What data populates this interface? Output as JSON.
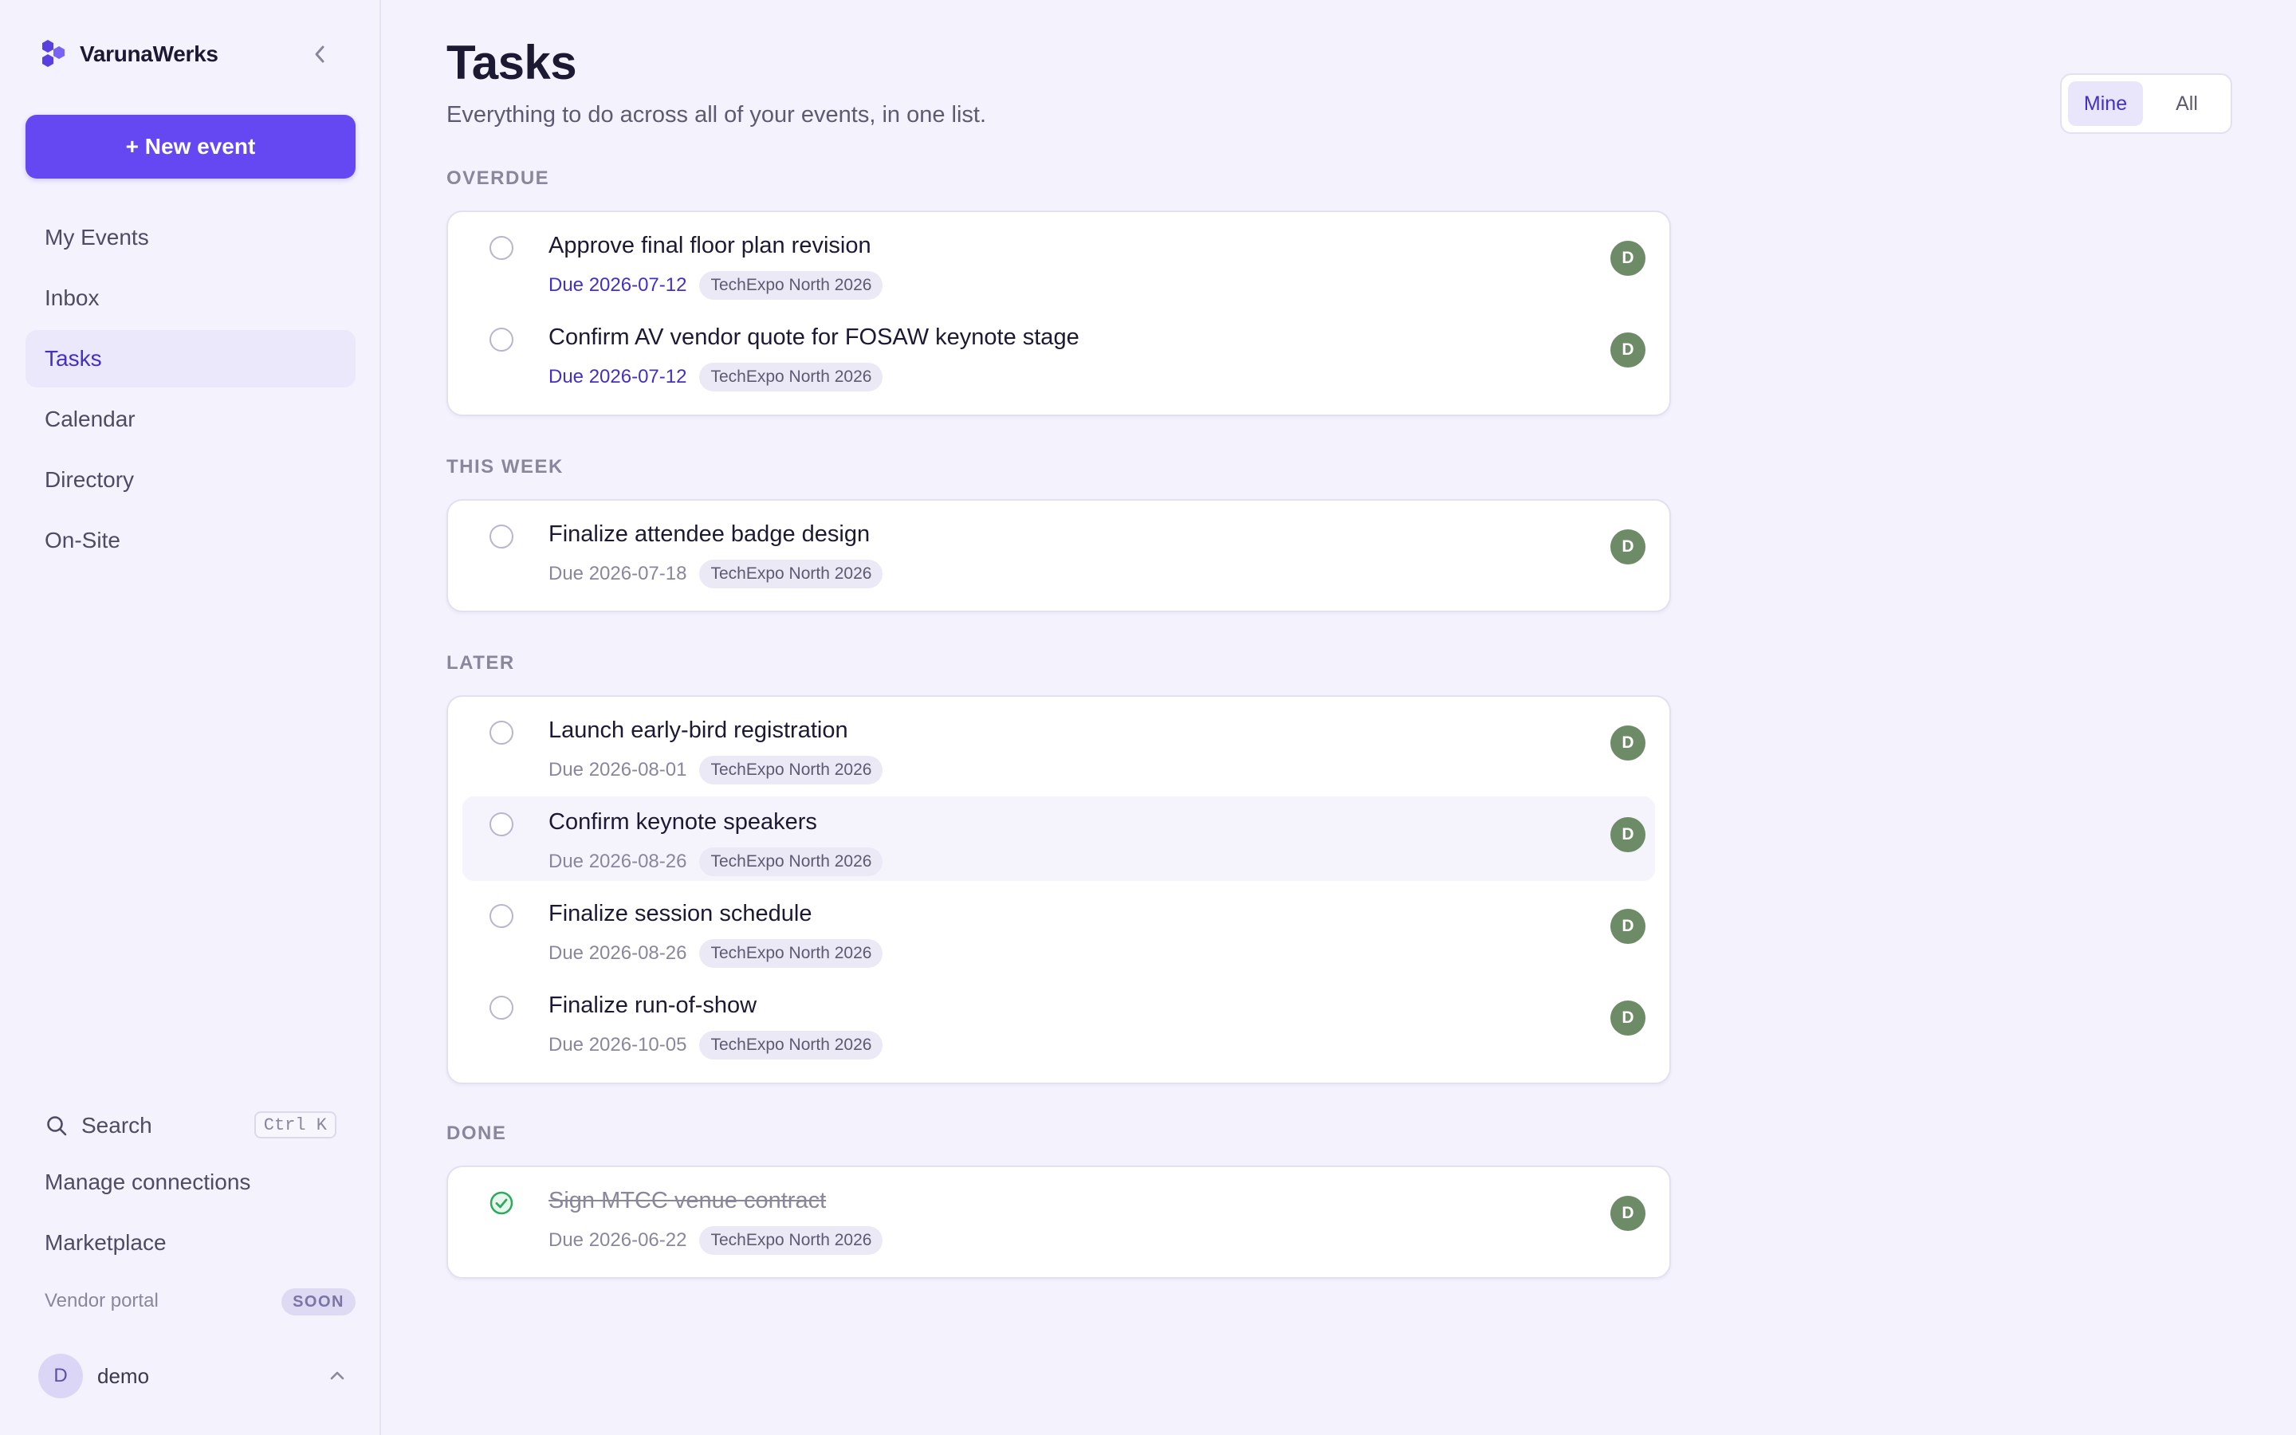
{
  "app": {
    "brand": "VarunaWerks",
    "new_event_label": "+ New event",
    "nav": [
      {
        "label": "My Events",
        "active": false
      },
      {
        "label": "Inbox",
        "active": false
      },
      {
        "label": "Tasks",
        "active": true
      },
      {
        "label": "Calendar",
        "active": false
      },
      {
        "label": "Directory",
        "active": false
      },
      {
        "label": "On-Site",
        "active": false
      }
    ],
    "search": {
      "label": "Search",
      "shortcut": "Ctrl K"
    },
    "links": {
      "manage_connections": "Manage connections",
      "marketplace": "Marketplace"
    },
    "vendor_portal": {
      "label": "Vendor portal",
      "badge": "SOON"
    },
    "user": {
      "initial": "D",
      "name": "demo"
    }
  },
  "page": {
    "title": "Tasks",
    "subtitle": "Everything to do across all of your events, in one list.",
    "filter": {
      "options": [
        "Mine",
        "All"
      ],
      "selected": "Mine"
    }
  },
  "colors": {
    "accent": "#6548f1",
    "accent_text": "#4330c4",
    "assignee_avatar": "#6d8b66",
    "done_check": "#2fa860"
  },
  "icons": {
    "logo": "hexagon-cluster-logo-icon",
    "collapse": "chevron-left-icon",
    "search": "search-icon",
    "user_menu": "chevron-up-icon",
    "checkbox": "circle-checkbox-icon",
    "done": "check-circle-icon"
  },
  "sections": [
    {
      "label": "OVERDUE",
      "tasks": [
        {
          "title": "Approve final floor plan revision",
          "due": "Due 2026-07-12",
          "event": "TechExpo North 2026",
          "assignee": "D",
          "overdue": true
        },
        {
          "title": "Confirm AV vendor quote for FOSAW keynote stage",
          "due": "Due 2026-07-12",
          "event": "TechExpo North 2026",
          "assignee": "D",
          "overdue": true
        }
      ]
    },
    {
      "label": "THIS WEEK",
      "tasks": [
        {
          "title": "Finalize attendee badge design",
          "due": "Due 2026-07-18",
          "event": "TechExpo North 2026",
          "assignee": "D"
        }
      ]
    },
    {
      "label": "LATER",
      "tasks": [
        {
          "title": "Launch early-bird registration",
          "due": "Due 2026-08-01",
          "event": "TechExpo North 2026",
          "assignee": "D"
        },
        {
          "title": "Confirm keynote speakers",
          "due": "Due 2026-08-26",
          "event": "TechExpo North 2026",
          "assignee": "D"
        },
        {
          "title": "Finalize session schedule",
          "due": "Due 2026-08-26",
          "event": "TechExpo North 2026",
          "assignee": "D"
        },
        {
          "title": "Finalize run-of-show",
          "due": "Due 2026-10-05",
          "event": "TechExpo North 2026",
          "assignee": "D"
        }
      ]
    },
    {
      "label": "DONE",
      "tasks": [
        {
          "title": "Sign MTCC venue contract",
          "due": "Due 2026-06-22",
          "event": "TechExpo North 2026",
          "assignee": "D",
          "done": true
        }
      ]
    }
  ]
}
